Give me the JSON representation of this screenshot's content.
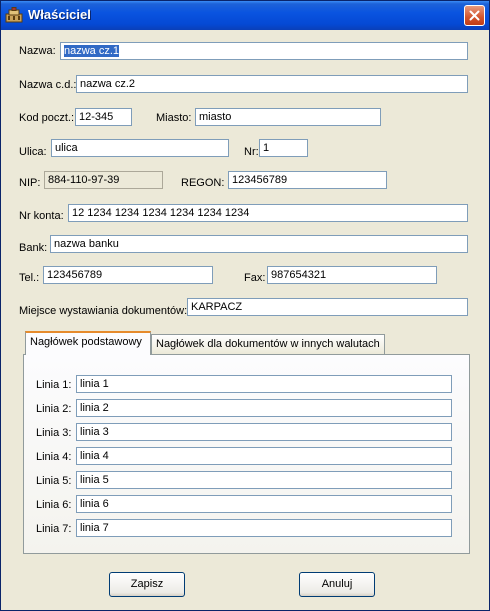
{
  "window": {
    "title": "Właściciel"
  },
  "form": {
    "nazwa": {
      "label": "Nazwa:",
      "value": "nazwa cz.1"
    },
    "nazwa_cd": {
      "label": "Nazwa c.d.:",
      "value": "nazwa cz.2"
    },
    "kod": {
      "label": "Kod poczt.:",
      "value": "12-345"
    },
    "miasto": {
      "label": "Miasto:",
      "value": "miasto"
    },
    "ulica": {
      "label": "Ulica:",
      "value": "ulica"
    },
    "nr": {
      "label": "Nr:",
      "value": "1"
    },
    "nip": {
      "label": "NIP:",
      "value": "884-110-97-39"
    },
    "regon": {
      "label": "REGON:",
      "value": "123456789"
    },
    "nr_konta": {
      "label": "Nr konta:",
      "value": "12 1234 1234 1234 1234 1234 1234"
    },
    "bank": {
      "label": "Bank:",
      "value": "nazwa banku"
    },
    "tel": {
      "label": "Tel.:",
      "value": "123456789"
    },
    "fax": {
      "label": "Fax:",
      "value": "987654321"
    },
    "miejsce": {
      "label": "Miejsce wystawiania dokumentów:",
      "value": "KARPACZ"
    }
  },
  "tabs": [
    {
      "label": "Nagłówek podstawowy",
      "active": true
    },
    {
      "label": "Nagłówek dla dokumentów w innych walutach",
      "active": false
    }
  ],
  "lines": [
    {
      "label": "Linia 1:",
      "value": "linia 1"
    },
    {
      "label": "Linia 2:",
      "value": "linia 2"
    },
    {
      "label": "Linia 3:",
      "value": "linia 3"
    },
    {
      "label": "Linia 4:",
      "value": "linia 4"
    },
    {
      "label": "Linia 5:",
      "value": "linia 5"
    },
    {
      "label": "Linia 6:",
      "value": "linia 6"
    },
    {
      "label": "Linia 7:",
      "value": "linia 7"
    }
  ],
  "buttons": {
    "save": "Zapisz",
    "cancel": "Anuluj"
  },
  "colors": {
    "titlebar": "#0a54e0",
    "selection": "#316ac5",
    "window_bg": "#ece9d8",
    "active_tab_accent": "#e68b2c"
  }
}
